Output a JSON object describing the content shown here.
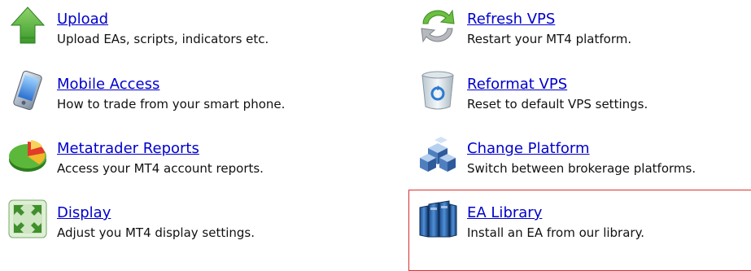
{
  "items": [
    {
      "title": "Upload",
      "desc": "Upload EAs, scripts, indicators etc.",
      "icon": "upload-arrow-icon"
    },
    {
      "title": "Mobile Access",
      "desc": "How to trade from your smart phone.",
      "icon": "smartphone-icon"
    },
    {
      "title": "Metatrader Reports",
      "desc": "Access your MT4 account reports.",
      "icon": "pie-chart-icon"
    },
    {
      "title": "Display",
      "desc": "Adjust you MT4 display settings.",
      "icon": "fullscreen-icon"
    },
    {
      "title": "Refresh VPS",
      "desc": "Restart your MT4 platform.",
      "icon": "refresh-icon"
    },
    {
      "title": "Reformat VPS",
      "desc": "Reset to default VPS settings.",
      "icon": "recycle-bin-icon"
    },
    {
      "title": "Change Platform",
      "desc": "Switch between brokerage platforms.",
      "icon": "cubes-icon"
    },
    {
      "title": "EA Library",
      "desc": "Install an EA from our library.",
      "icon": "books-icon"
    }
  ],
  "colors": {
    "link": "#0000cc",
    "highlight_border": "#d9302f"
  }
}
